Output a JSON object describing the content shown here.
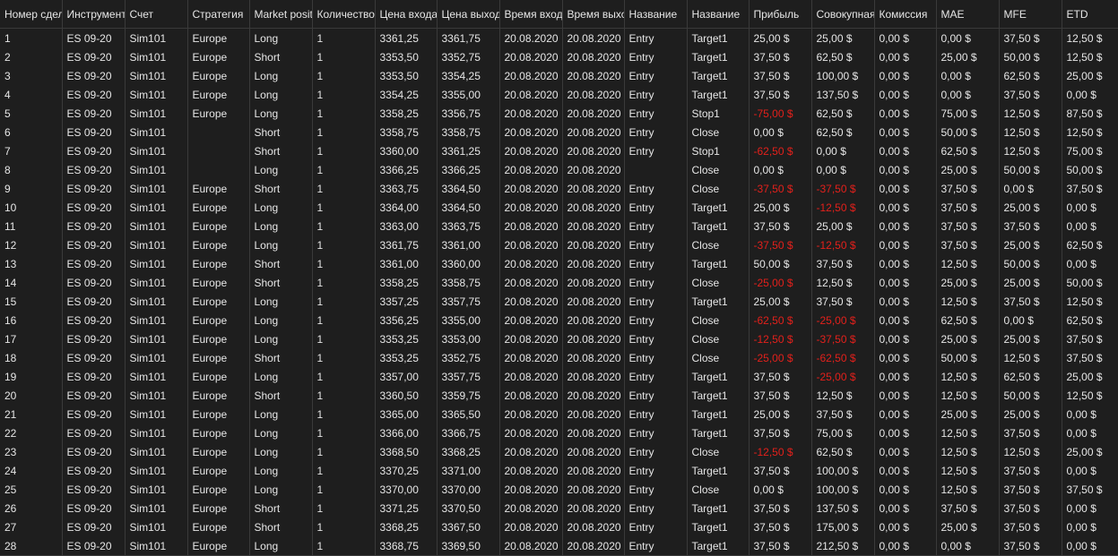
{
  "colors": {
    "background": "#1e1e1e",
    "text": "#e6e6e6",
    "negative": "#e3201b",
    "gridline": "#3a3a3a"
  },
  "columns": [
    {
      "key": "num",
      "label": "Номер сделки"
    },
    {
      "key": "instrument",
      "label": "Инструмент"
    },
    {
      "key": "account",
      "label": "Счет"
    },
    {
      "key": "strategy",
      "label": "Стратегия"
    },
    {
      "key": "position",
      "label": "Market position"
    },
    {
      "key": "qty",
      "label": "Количество"
    },
    {
      "key": "entry_price",
      "label": "Цена входа"
    },
    {
      "key": "exit_price",
      "label": "Цена выхода"
    },
    {
      "key": "entry_time",
      "label": "Время входа"
    },
    {
      "key": "exit_time",
      "label": "Время выхода"
    },
    {
      "key": "entry_name",
      "label": "Название"
    },
    {
      "key": "exit_name",
      "label": "Название"
    },
    {
      "key": "profit",
      "label": "Прибыль"
    },
    {
      "key": "cumulative",
      "label": "Совокупная прибыль"
    },
    {
      "key": "commission",
      "label": "Комиссия"
    },
    {
      "key": "mae",
      "label": "MAE"
    },
    {
      "key": "mfe",
      "label": "MFE"
    },
    {
      "key": "etd",
      "label": "ETD"
    }
  ],
  "trades": [
    [
      "1",
      "ES 09-20",
      "Sim101",
      "Europe",
      "Long",
      "1",
      "3361,25",
      "3361,75",
      "20.08.2020",
      "20.08.2020",
      "Entry",
      "Target1",
      "25,00 $",
      "25,00 $",
      "0,00 $",
      "0,00 $",
      "37,50 $",
      "12,50 $"
    ],
    [
      "2",
      "ES 09-20",
      "Sim101",
      "Europe",
      "Short",
      "1",
      "3353,50",
      "3352,75",
      "20.08.2020",
      "20.08.2020",
      "Entry",
      "Target1",
      "37,50 $",
      "62,50 $",
      "0,00 $",
      "25,00 $",
      "50,00 $",
      "12,50 $"
    ],
    [
      "3",
      "ES 09-20",
      "Sim101",
      "Europe",
      "Long",
      "1",
      "3353,50",
      "3354,25",
      "20.08.2020",
      "20.08.2020",
      "Entry",
      "Target1",
      "37,50 $",
      "100,00 $",
      "0,00 $",
      "0,00 $",
      "62,50 $",
      "25,00 $"
    ],
    [
      "4",
      "ES 09-20",
      "Sim101",
      "Europe",
      "Long",
      "1",
      "3354,25",
      "3355,00",
      "20.08.2020",
      "20.08.2020",
      "Entry",
      "Target1",
      "37,50 $",
      "137,50 $",
      "0,00 $",
      "0,00 $",
      "37,50 $",
      "0,00 $"
    ],
    [
      "5",
      "ES 09-20",
      "Sim101",
      "Europe",
      "Long",
      "1",
      "3358,25",
      "3356,75",
      "20.08.2020",
      "20.08.2020",
      "Entry",
      "Stop1",
      "-75,00 $",
      "62,50 $",
      "0,00 $",
      "75,00 $",
      "12,50 $",
      "87,50 $"
    ],
    [
      "6",
      "ES 09-20",
      "Sim101",
      "",
      "Short",
      "1",
      "3358,75",
      "3358,75",
      "20.08.2020",
      "20.08.2020",
      "Entry",
      "Close",
      "0,00 $",
      "62,50 $",
      "0,00 $",
      "50,00 $",
      "12,50 $",
      "12,50 $"
    ],
    [
      "7",
      "ES 09-20",
      "Sim101",
      "",
      "Short",
      "1",
      "3360,00",
      "3361,25",
      "20.08.2020",
      "20.08.2020",
      "Entry",
      "Stop1",
      "-62,50 $",
      "0,00 $",
      "0,00 $",
      "62,50 $",
      "12,50 $",
      "75,00 $"
    ],
    [
      "8",
      "ES 09-20",
      "Sim101",
      "",
      "Long",
      "1",
      "3366,25",
      "3366,25",
      "20.08.2020",
      "20.08.2020",
      "",
      "Close",
      "0,00 $",
      "0,00 $",
      "0,00 $",
      "25,00 $",
      "50,00 $",
      "50,00 $"
    ],
    [
      "9",
      "ES 09-20",
      "Sim101",
      "Europe",
      "Short",
      "1",
      "3363,75",
      "3364,50",
      "20.08.2020",
      "20.08.2020",
      "Entry",
      "Close",
      "-37,50 $",
      "-37,50 $",
      "0,00 $",
      "37,50 $",
      "0,00 $",
      "37,50 $"
    ],
    [
      "10",
      "ES 09-20",
      "Sim101",
      "Europe",
      "Long",
      "1",
      "3364,00",
      "3364,50",
      "20.08.2020",
      "20.08.2020",
      "Entry",
      "Target1",
      "25,00 $",
      "-12,50 $",
      "0,00 $",
      "37,50 $",
      "25,00 $",
      "0,00 $"
    ],
    [
      "11",
      "ES 09-20",
      "Sim101",
      "Europe",
      "Long",
      "1",
      "3363,00",
      "3363,75",
      "20.08.2020",
      "20.08.2020",
      "Entry",
      "Target1",
      "37,50 $",
      "25,00 $",
      "0,00 $",
      "37,50 $",
      "37,50 $",
      "0,00 $"
    ],
    [
      "12",
      "ES 09-20",
      "Sim101",
      "Europe",
      "Long",
      "1",
      "3361,75",
      "3361,00",
      "20.08.2020",
      "20.08.2020",
      "Entry",
      "Close",
      "-37,50 $",
      "-12,50 $",
      "0,00 $",
      "37,50 $",
      "25,00 $",
      "62,50 $"
    ],
    [
      "13",
      "ES 09-20",
      "Sim101",
      "Europe",
      "Short",
      "1",
      "3361,00",
      "3360,00",
      "20.08.2020",
      "20.08.2020",
      "Entry",
      "Target1",
      "50,00 $",
      "37,50 $",
      "0,00 $",
      "12,50 $",
      "50,00 $",
      "0,00 $"
    ],
    [
      "14",
      "ES 09-20",
      "Sim101",
      "Europe",
      "Short",
      "1",
      "3358,25",
      "3358,75",
      "20.08.2020",
      "20.08.2020",
      "Entry",
      "Close",
      "-25,00 $",
      "12,50 $",
      "0,00 $",
      "25,00 $",
      "25,00 $",
      "50,00 $"
    ],
    [
      "15",
      "ES 09-20",
      "Sim101",
      "Europe",
      "Long",
      "1",
      "3357,25",
      "3357,75",
      "20.08.2020",
      "20.08.2020",
      "Entry",
      "Target1",
      "25,00 $",
      "37,50 $",
      "0,00 $",
      "12,50 $",
      "37,50 $",
      "12,50 $"
    ],
    [
      "16",
      "ES 09-20",
      "Sim101",
      "Europe",
      "Long",
      "1",
      "3356,25",
      "3355,00",
      "20.08.2020",
      "20.08.2020",
      "Entry",
      "Close",
      "-62,50 $",
      "-25,00 $",
      "0,00 $",
      "62,50 $",
      "0,00 $",
      "62,50 $"
    ],
    [
      "17",
      "ES 09-20",
      "Sim101",
      "Europe",
      "Long",
      "1",
      "3353,25",
      "3353,00",
      "20.08.2020",
      "20.08.2020",
      "Entry",
      "Close",
      "-12,50 $",
      "-37,50 $",
      "0,00 $",
      "25,00 $",
      "25,00 $",
      "37,50 $"
    ],
    [
      "18",
      "ES 09-20",
      "Sim101",
      "Europe",
      "Short",
      "1",
      "3353,25",
      "3352,75",
      "20.08.2020",
      "20.08.2020",
      "Entry",
      "Close",
      "-25,00 $",
      "-62,50 $",
      "0,00 $",
      "50,00 $",
      "12,50 $",
      "37,50 $"
    ],
    [
      "19",
      "ES 09-20",
      "Sim101",
      "Europe",
      "Long",
      "1",
      "3357,00",
      "3357,75",
      "20.08.2020",
      "20.08.2020",
      "Entry",
      "Target1",
      "37,50 $",
      "-25,00 $",
      "0,00 $",
      "12,50 $",
      "62,50 $",
      "25,00 $"
    ],
    [
      "20",
      "ES 09-20",
      "Sim101",
      "Europe",
      "Short",
      "1",
      "3360,50",
      "3359,75",
      "20.08.2020",
      "20.08.2020",
      "Entry",
      "Target1",
      "37,50 $",
      "12,50 $",
      "0,00 $",
      "12,50 $",
      "50,00 $",
      "12,50 $"
    ],
    [
      "21",
      "ES 09-20",
      "Sim101",
      "Europe",
      "Long",
      "1",
      "3365,00",
      "3365,50",
      "20.08.2020",
      "20.08.2020",
      "Entry",
      "Target1",
      "25,00 $",
      "37,50 $",
      "0,00 $",
      "25,00 $",
      "25,00 $",
      "0,00 $"
    ],
    [
      "22",
      "ES 09-20",
      "Sim101",
      "Europe",
      "Long",
      "1",
      "3366,00",
      "3366,75",
      "20.08.2020",
      "20.08.2020",
      "Entry",
      "Target1",
      "37,50 $",
      "75,00 $",
      "0,00 $",
      "12,50 $",
      "37,50 $",
      "0,00 $"
    ],
    [
      "23",
      "ES 09-20",
      "Sim101",
      "Europe",
      "Long",
      "1",
      "3368,50",
      "3368,25",
      "20.08.2020",
      "20.08.2020",
      "Entry",
      "Close",
      "-12,50 $",
      "62,50 $",
      "0,00 $",
      "12,50 $",
      "12,50 $",
      "25,00 $"
    ],
    [
      "24",
      "ES 09-20",
      "Sim101",
      "Europe",
      "Long",
      "1",
      "3370,25",
      "3371,00",
      "20.08.2020",
      "20.08.2020",
      "Entry",
      "Target1",
      "37,50 $",
      "100,00 $",
      "0,00 $",
      "12,50 $",
      "37,50 $",
      "0,00 $"
    ],
    [
      "25",
      "ES 09-20",
      "Sim101",
      "Europe",
      "Long",
      "1",
      "3370,00",
      "3370,00",
      "20.08.2020",
      "20.08.2020",
      "Entry",
      "Close",
      "0,00 $",
      "100,00 $",
      "0,00 $",
      "12,50 $",
      "37,50 $",
      "37,50 $"
    ],
    [
      "26",
      "ES 09-20",
      "Sim101",
      "Europe",
      "Short",
      "1",
      "3371,25",
      "3370,50",
      "20.08.2020",
      "20.08.2020",
      "Entry",
      "Target1",
      "37,50 $",
      "137,50 $",
      "0,00 $",
      "37,50 $",
      "37,50 $",
      "0,00 $"
    ],
    [
      "27",
      "ES 09-20",
      "Sim101",
      "Europe",
      "Short",
      "1",
      "3368,25",
      "3367,50",
      "20.08.2020",
      "20.08.2020",
      "Entry",
      "Target1",
      "37,50 $",
      "175,00 $",
      "0,00 $",
      "25,00 $",
      "37,50 $",
      "0,00 $"
    ],
    [
      "28",
      "ES 09-20",
      "Sim101",
      "Europe",
      "Long",
      "1",
      "3368,75",
      "3369,50",
      "20.08.2020",
      "20.08.2020",
      "Entry",
      "Target1",
      "37,50 $",
      "212,50 $",
      "0,00 $",
      "0,00 $",
      "37,50 $",
      "0,00 $"
    ]
  ]
}
